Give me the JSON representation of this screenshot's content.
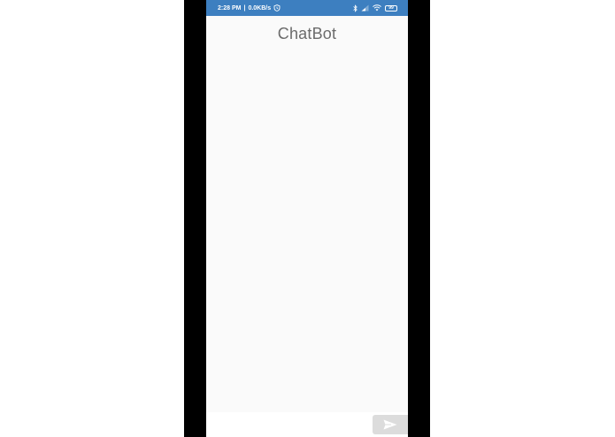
{
  "status_bar": {
    "time": "2:28 PM",
    "separator": "|",
    "network_speed": "0.0KB/s",
    "battery_level": "99",
    "background_color": "#3d7fc0",
    "left_icons": [
      "shield-alarm-icon"
    ],
    "right_icons": [
      "bluetooth-icon",
      "signal-icon",
      "wifi-icon",
      "battery-icon"
    ]
  },
  "header": {
    "title": "ChatBot"
  },
  "composer": {
    "input_value": "",
    "send_icon": "send-icon"
  },
  "colors": {
    "frame": "#000000",
    "app_background": "#fafafa",
    "title_text": "#6b6b6b",
    "send_button": "#dcdcdc"
  }
}
